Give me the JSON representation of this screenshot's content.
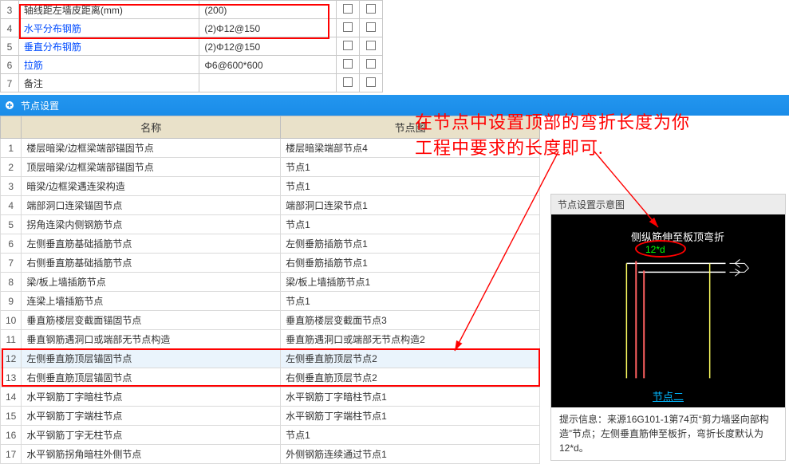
{
  "top_rows": [
    {
      "n": "3",
      "label": "轴线距左墙皮距离(mm)",
      "val": "(200)",
      "link": false
    },
    {
      "n": "4",
      "label": "水平分布钢筋",
      "val": "(2)Φ12@150",
      "link": true
    },
    {
      "n": "5",
      "label": "垂直分布钢筋",
      "val": "(2)Φ12@150",
      "link": true
    },
    {
      "n": "6",
      "label": "拉筋",
      "val": "Φ6@600*600",
      "link": true
    },
    {
      "n": "7",
      "label": "备注",
      "val": "",
      "link": false
    }
  ],
  "panel_title": "节点设置",
  "node_headers": [
    "",
    "名称",
    "节点图"
  ],
  "node_rows": [
    {
      "n": "1",
      "name": "楼层暗梁/边框梁端部锚固节点",
      "img": "楼层暗梁端部节点4"
    },
    {
      "n": "2",
      "name": "顶层暗梁/边框梁端部锚固节点",
      "img": "节点1"
    },
    {
      "n": "3",
      "name": "暗梁/边框梁遇连梁构造",
      "img": "节点1"
    },
    {
      "n": "4",
      "name": "端部洞口连梁锚固节点",
      "img": "端部洞口连梁节点1"
    },
    {
      "n": "5",
      "name": "拐角连梁内侧钢筋节点",
      "img": "节点1"
    },
    {
      "n": "6",
      "name": "左侧垂直筋基础插筋节点",
      "img": "左侧垂筋插筋节点1"
    },
    {
      "n": "7",
      "name": "右侧垂直筋基础插筋节点",
      "img": "右侧垂筋插筋节点1"
    },
    {
      "n": "8",
      "name": "梁/板上墙插筋节点",
      "img": "梁/板上墙插筋节点1"
    },
    {
      "n": "9",
      "name": "连梁上墙插筋节点",
      "img": "节点1"
    },
    {
      "n": "10",
      "name": "垂直筋楼层变截面锚固节点",
      "img": "垂直筋楼层变截面节点3"
    },
    {
      "n": "11",
      "name": "垂直钢筋遇洞口或端部无节点构造",
      "img": "垂直筋遇洞口或端部无节点构造2"
    },
    {
      "n": "12",
      "name": "左侧垂直筋顶层锚固节点",
      "img": "左侧垂直筋顶层节点2",
      "sel": true
    },
    {
      "n": "13",
      "name": "右侧垂直筋顶层锚固节点",
      "img": "右侧垂直筋顶层节点2"
    },
    {
      "n": "14",
      "name": "水平钢筋丁字暗柱节点",
      "img": "水平钢筋丁字暗柱节点1"
    },
    {
      "n": "15",
      "name": "水平钢筋丁字端柱节点",
      "img": "水平钢筋丁字端柱节点1"
    },
    {
      "n": "16",
      "name": "水平钢筋丁字无柱节点",
      "img": "节点1"
    },
    {
      "n": "17",
      "name": "水平钢筋拐角暗柱外侧节点",
      "img": "外侧钢筋连续通过节点1"
    }
  ],
  "right_header": "节点设置示意图",
  "preview_toptext": "侧纵筋伸至板顶弯折",
  "preview_dim": "12*d",
  "preview_link": "节点二",
  "tip_label": "提示信息：",
  "tip_text": "来源16G101-1第74页“剪力墙竖向部构造”节点；左侧垂直筋伸至板折，弯折长度默认为12*d。",
  "anno_line1": "在节点中设置顶部的弯折长度为你",
  "anno_line2": "工程中要求的长度即可."
}
